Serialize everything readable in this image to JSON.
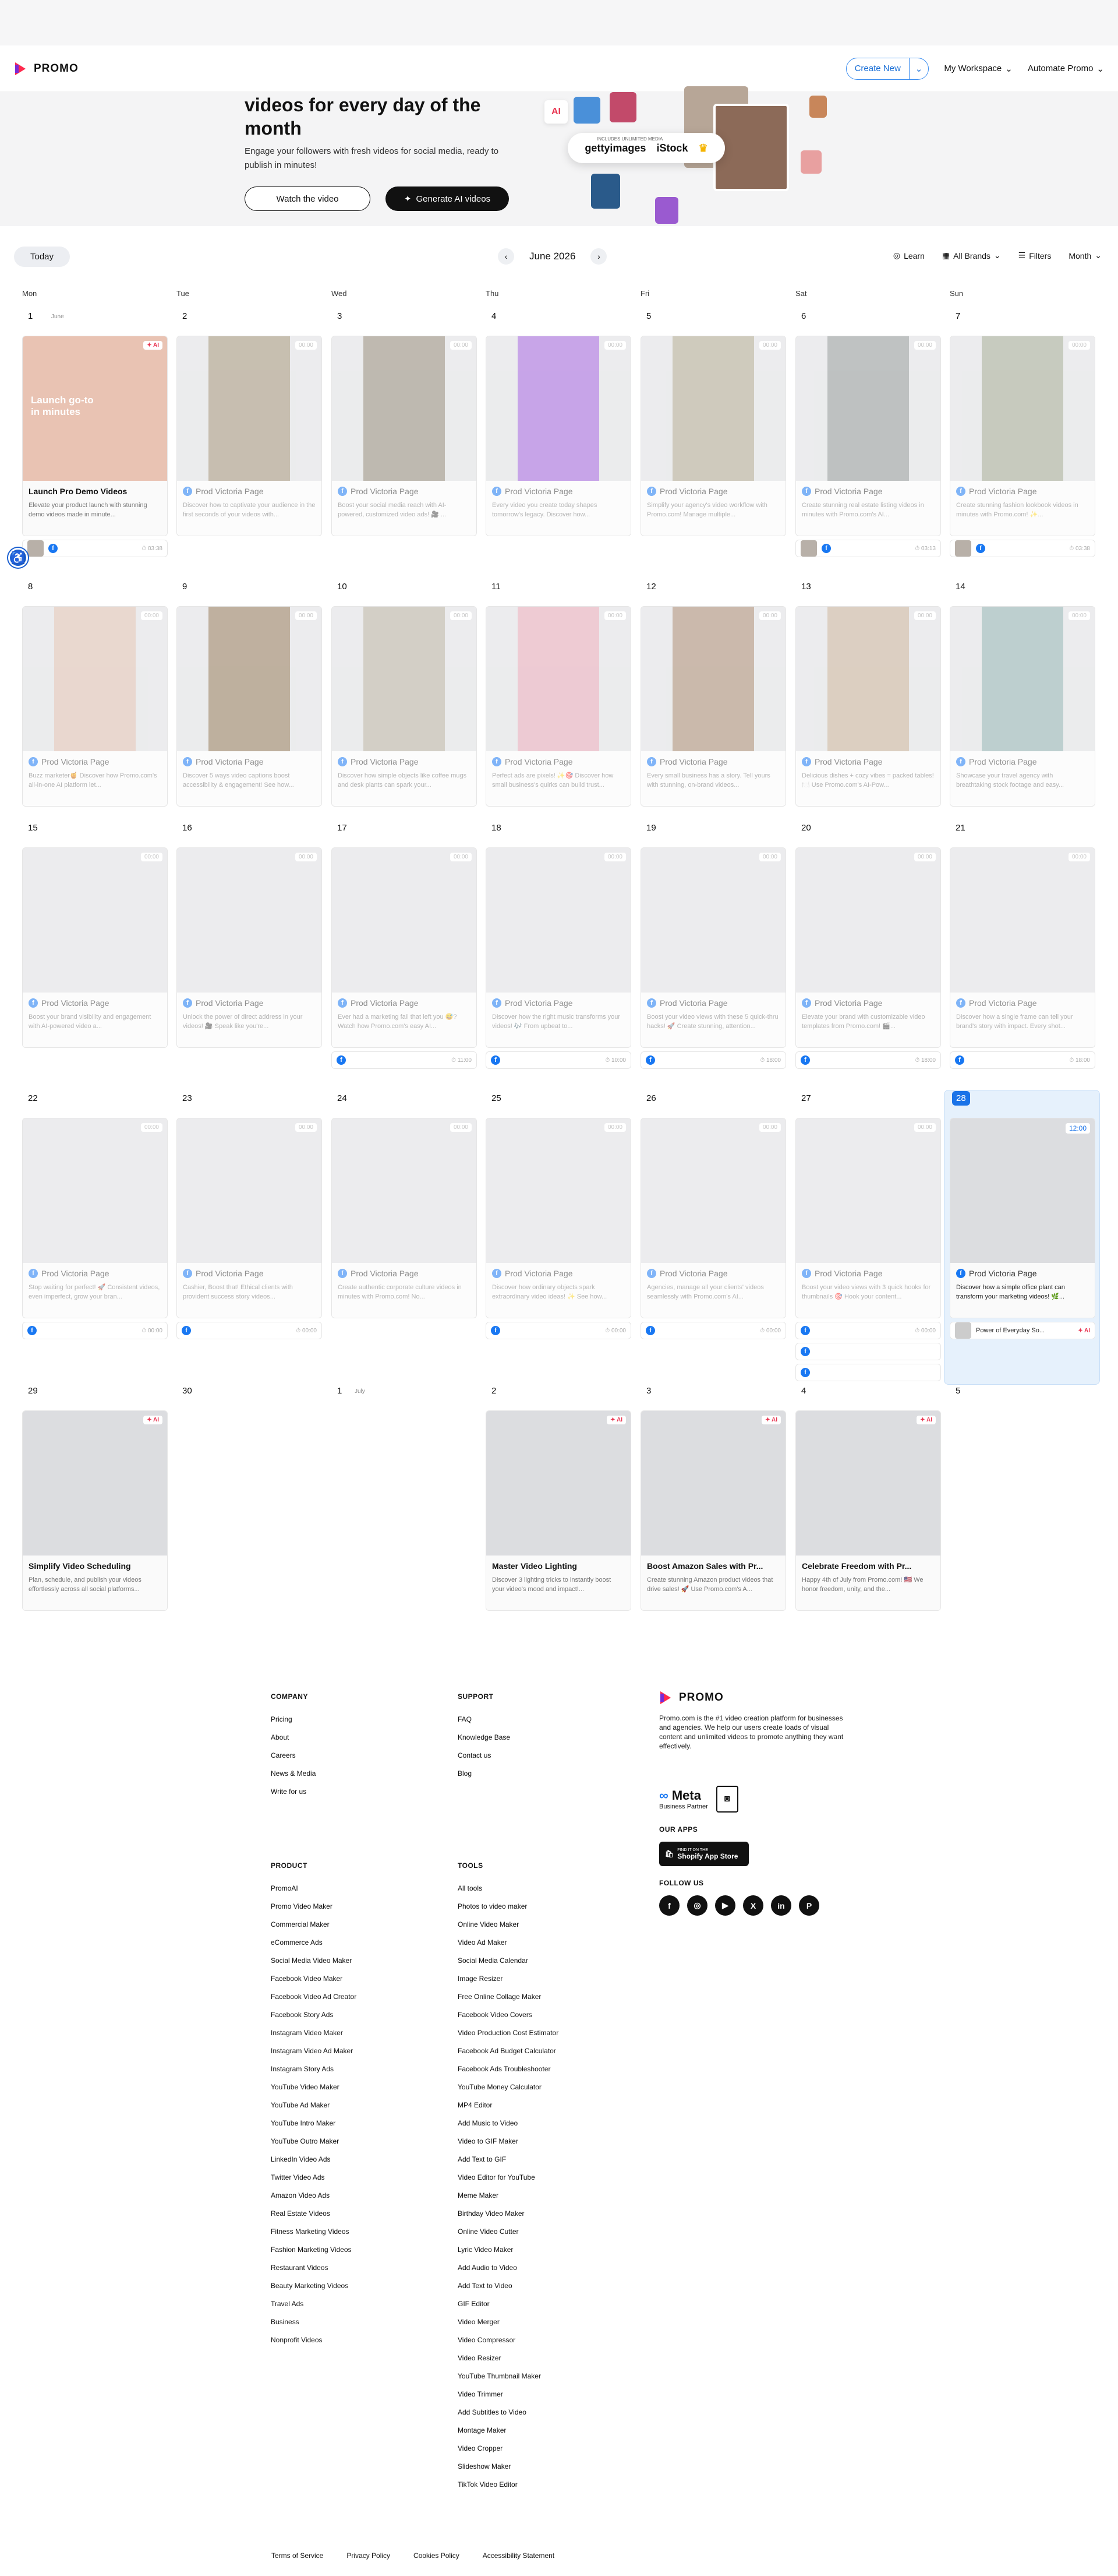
{
  "brand": {
    "name": "PROMO"
  },
  "nav": {
    "create_new": "Create New",
    "workspace": "My Workspace",
    "automate": "Automate Promo"
  },
  "hero": {
    "title": "videos for every day of the month",
    "subtitle": "Engage your followers with fresh videos for social media, ready to publish in minutes!",
    "watch_btn": "Watch the video",
    "generate_btn": "Generate AI videos",
    "media_label": "INCLUDES UNLIMITED MEDIA",
    "getty": "gettyimages",
    "istock": "iStock",
    "ai_label": "AI"
  },
  "toolbar": {
    "today": "Today",
    "month_label": "June 2026",
    "learn": "Learn",
    "brands": "All Brands",
    "filters": "Filters",
    "view": "Month"
  },
  "weekdays": [
    "Mon",
    "Tue",
    "Wed",
    "Thu",
    "Fri",
    "Sat",
    "Sun"
  ],
  "month_names": {
    "june": "June",
    "july": "July"
  },
  "page_name": "Prod Victoria Page",
  "weeks": [
    {
      "days": [
        "1",
        "2",
        "3",
        "4",
        "5",
        "6",
        "7"
      ],
      "cards": [
        {
          "title": "Launch Pro Demo Videos",
          "desc": "Elevate your product launch with stunning demo videos made in minute...",
          "tag": "AI",
          "ai": true,
          "time": "03:38",
          "thumb": "#e9c3b3",
          "overlay": "Launch go-to in minutes"
        },
        {
          "desc": "Discover how to captivate your audience in the first seconds of your videos with...",
          "tag": "00:00",
          "thumb": "#9a8a70"
        },
        {
          "desc": "Boost your social media reach with AI-powered, customized video ads! 🎥 ...",
          "tag": "00:00",
          "thumb": "#8a8070"
        },
        {
          "desc": "Every video you create today shapes tomorrow's legacy. Discover how...",
          "tag": "00:00",
          "thumb": "#9b5bd6"
        },
        {
          "desc": "Simplify your agency's video workflow with Promo.com! Manage multiple...",
          "tag": "00:00",
          "thumb": "#a8a088"
        },
        {
          "desc": "Create stunning real estate listing videos in minutes with Promo.com's AI...",
          "tag": "00:00",
          "thumb": "#8a9090",
          "time": "03:13"
        },
        {
          "desc": "Create stunning fashion lookbook videos in minutes with Promo.com! ✨...",
          "tag": "00:00",
          "thumb": "#9aa08a",
          "time": "03:38"
        }
      ]
    },
    {
      "days": [
        "8",
        "9",
        "10",
        "11",
        "12",
        "13",
        "14"
      ],
      "cards": [
        {
          "desc": "Buzz marketer🍯 Discover how Promo.com's all-in-one AI platform let...",
          "tag": "00:00",
          "thumb": "#d8b8a8"
        },
        {
          "desc": "Discover 5 ways video captions boost accessibility & engagement! See how...",
          "tag": "00:00",
          "thumb": "#8a7050"
        },
        {
          "desc": "Discover how simple objects like coffee mugs and desk plants can spark your...",
          "tag": "00:00",
          "thumb": "#b0a898"
        },
        {
          "desc": "Perfect ads are pixels! ✨🎯 Discover how small business's quirks can build trust...",
          "tag": "00:00",
          "thumb": "#e0a0b0"
        },
        {
          "desc": "Every small business has a story. Tell yours with stunning, on-brand videos...",
          "tag": "00:00",
          "thumb": "#a08068"
        },
        {
          "desc": "Delicious dishes + cozy vibes = packed tables! 🍽️ Use Promo.com's AI-Pow...",
          "tag": "00:00",
          "thumb": "#c0a890"
        },
        {
          "desc": "Showcase your travel agency with breathtaking stock footage and easy...",
          "tag": "00:00",
          "thumb": "#88a8a8"
        }
      ]
    },
    {
      "days": [
        "15",
        "16",
        "17",
        "18",
        "19",
        "20",
        "21"
      ],
      "cards": [
        {
          "desc": "Boost your brand visibility and engagement with AI-powered video a...",
          "tag": "00:00"
        },
        {
          "desc": "Unlock the power of direct address in your videos! 🎥 Speak like you're...",
          "tag": "00:00"
        },
        {
          "desc": "Ever had a marketing fail that left you 😅? Watch how Promo.com's easy AI...",
          "tag": "00:00",
          "time": "11:00"
        },
        {
          "desc": "Discover how the right music transforms your videos! 🎶 From upbeat to...",
          "tag": "00:00",
          "time": "10:00"
        },
        {
          "desc": "Boost your video views with these 5 quick-thru hacks! 🚀 Create stunning, attention...",
          "tag": "00:00",
          "time": "18:00"
        },
        {
          "desc": "Elevate your brand with customizable video templates from Promo.com! 🎬...",
          "tag": "00:00",
          "time": "18:00"
        },
        {
          "desc": "Discover how a single frame can tell your brand's story with impact. Every shot...",
          "tag": "00:00",
          "time": "18:00"
        }
      ]
    },
    {
      "days": [
        "22",
        "23",
        "24",
        "25",
        "26",
        "27",
        "28"
      ],
      "cards": [
        {
          "desc": "Stop waiting for perfect! 🚀 Consistent videos, even imperfect, grow your bran...",
          "tag": "00:00",
          "time": "00:00"
        },
        {
          "desc": "Cashier, Boost that! Ethical clients with provident success story videos...",
          "tag": "00:00",
          "time": "00:00"
        },
        {
          "desc": "Create authentic corporate culture videos in minutes with Promo.com! No...",
          "tag": "00:00"
        },
        {
          "desc": "Discover how ordinary objects spark extraordinary video ideas! ✨ See how...",
          "tag": "00:00",
          "time": "00:00"
        },
        {
          "desc": "Agencies, manage all your clients' videos seamlessly with Promo.com's AI...",
          "tag": "00:00",
          "time": "00:00"
        },
        {
          "desc": "Boost your video views with 3 quick hooks for thumbnails 🎯 Hook your content...",
          "tag": "00:00",
          "time": "00:00"
        },
        {
          "desc": "Discover how a simple office plant can transform your marketing videos! 🌿...",
          "tag": "12:00",
          "selected": true,
          "sub": "Power of Everyday So..."
        }
      ]
    },
    {
      "days": [
        "29",
        "30",
        "1",
        "2",
        "3",
        "4",
        "5"
      ],
      "cards": [
        {
          "title": "Simplify Video Scheduling",
          "desc": "Plan, schedule, and publish your videos effortlessly across all social platforms...",
          "ai": true
        },
        null,
        null,
        {
          "title": "Master Video Lighting",
          "desc": "Discover 3 lighting tricks to instantly boost your video's mood and impact!...",
          "ai": true
        },
        {
          "title": "Boost Amazon Sales with Pr...",
          "desc": "Create stunning Amazon product videos that drive sales! 🚀 Use Promo.com's A...",
          "ai": true
        },
        {
          "title": "Celebrate Freedom with Pr...",
          "desc": "Happy 4th of July from Promo.com! 🇺🇸 We honor freedom, unity, and the...",
          "ai": true
        },
        null
      ]
    }
  ],
  "footer": {
    "company_h": "COMPANY",
    "company": [
      "Pricing",
      "About",
      "Careers",
      "News & Media",
      "Write for us"
    ],
    "support_h": "SUPPORT",
    "support": [
      "FAQ",
      "Knowledge Base",
      "Contact us",
      "Blog"
    ],
    "product_h": "PRODUCT",
    "product": [
      "PromoAI",
      "Promo Video Maker",
      "Commercial Maker",
      "eCommerce Ads",
      "Social Media Video Maker",
      "Facebook Video Maker",
      "Facebook Video Ad Creator",
      "Facebook Story Ads",
      "Instagram Video Maker",
      "Instagram Video Ad Maker",
      "Instagram Story Ads",
      "YouTube Video Maker",
      "YouTube Ad Maker",
      "YouTube Intro Maker",
      "YouTube Outro Maker",
      "LinkedIn Video Ads",
      "Twitter Video Ads",
      "Amazon Video Ads",
      "Real Estate Videos",
      "Fitness Marketing Videos",
      "Fashion Marketing Videos",
      "Restaurant Videos",
      "Beauty Marketing Videos",
      "Travel Ads",
      "Business",
      "Nonprofit Videos"
    ],
    "tools_h": "TOOLS",
    "tools": [
      "All tools",
      "Photos to video maker",
      "Online Video Maker",
      "Video Ad Maker",
      "Social Media Calendar",
      "Image Resizer",
      "Free Online Collage Maker",
      "Facebook Video Covers",
      "Video Production Cost Estimator",
      "Facebook Ad Budget Calculator",
      "Facebook Ads Troubleshooter",
      "YouTube Money Calculator",
      "MP4 Editor",
      "Add Music to Video",
      "Video to GIF Maker",
      "Add Text to GIF",
      "Video Editor for YouTube",
      "Meme Maker",
      "Birthday Video Maker",
      "Online Video Cutter",
      "Lyric Video Maker",
      "Add Audio to Video",
      "Add Text to Video",
      "GIF Editor",
      "Video Merger",
      "Video Compressor",
      "Video Resizer",
      "YouTube Thumbnail Maker",
      "Video Trimmer",
      "Add Subtitles to Video",
      "Montage Maker",
      "Video Cropper",
      "Slideshow Maker",
      "TikTok Video Editor"
    ],
    "about": "Promo.com is the #1 video creation platform for businesses and agencies. We help our users create loads of visual content and unlimited videos to promote anything they want effectively.",
    "meta": "Meta",
    "meta_sub": "Business Partner",
    "apps_h": "OUR APPS",
    "shopify": "Shopify App Store",
    "shopify_small": "FIND IT ON THE",
    "follow_h": "FOLLOW US",
    "legal": [
      "Terms of Service",
      "Privacy Policy",
      "Cookies Policy",
      "Accessibility Statement"
    ]
  }
}
